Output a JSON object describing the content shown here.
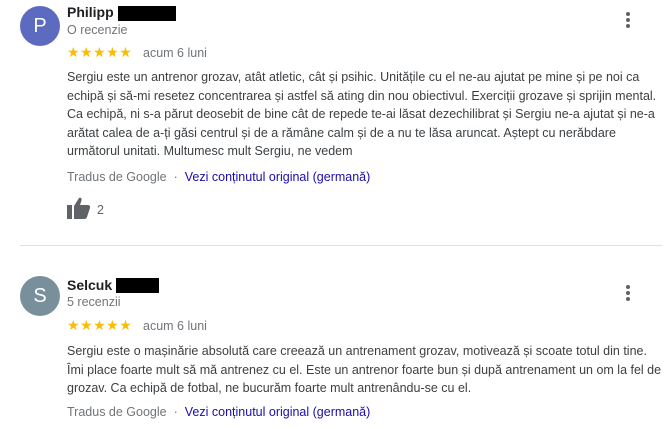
{
  "reviews": [
    {
      "initial": "P",
      "avatar_color": "#5c6bc0",
      "name": "Philipp",
      "review_count": "O recenzie",
      "rating": 5,
      "stars": "★★★★★",
      "date": "acum 6 luni",
      "text": "Sergiu este un antrenor grozav, atât atletic, cât și psihic. Unitățile cu el ne-au ajutat pe mine și pe noi ca echipă și să-mi resetez concentrarea și astfel să ating din nou obiectivul. Exerciții grozave și sprijin mental. Ca echipă, ni s-a părut deosebit de bine cât de repede te-ai lăsat dezechilibrat și Sergiu ne-a ajutat și ne-a arătat calea de a-ți găsi centrul și de a rămâne calm și de a nu te lăsa aruncat. Aștept cu nerăbdare următorul unitati. Multumesc mult Sergiu, ne vedem",
      "translated_by": "Tradus de Google",
      "separator": "·",
      "original_link": "Vezi conținutul original (germană)",
      "likes": "2"
    },
    {
      "initial": "S",
      "avatar_color": "#78909c",
      "name": "Selcuk",
      "review_count": "5 recenzii",
      "rating": 5,
      "stars": "★★★★★",
      "date": "acum 6 luni",
      "text": "Sergiu este o mașinărie absolută care creează un antrenament grozav, motivează și scoate totul din tine. Îmi place foarte mult să mă antrenez cu el. Este un antrenor foarte bun și după antrenament un om la fel de grozav. Ca echipă de fotbal, ne bucurăm foarte mult antrenându-se cu el.",
      "translated_by": "Tradus de Google",
      "separator": "·",
      "original_link": "Vezi conținutul original (germană)"
    }
  ]
}
